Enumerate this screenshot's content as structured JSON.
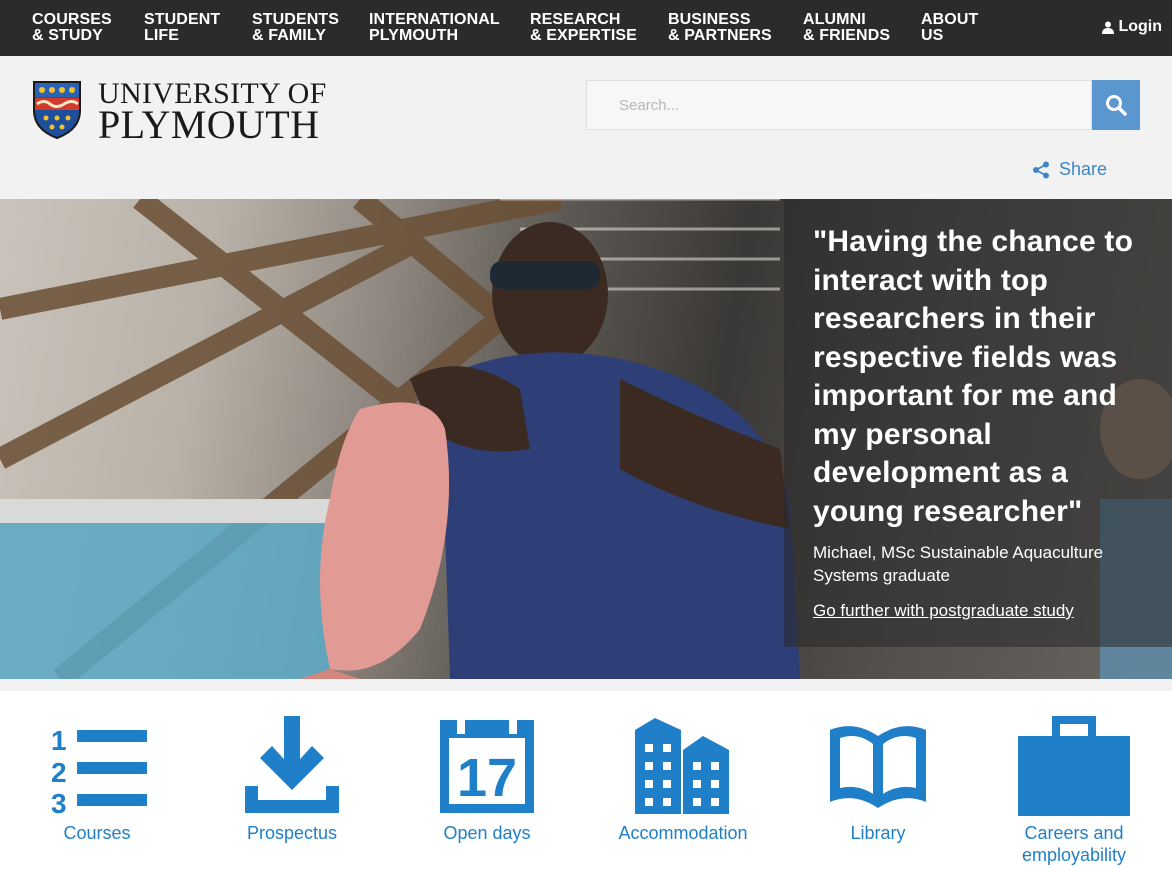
{
  "nav": {
    "items": [
      {
        "line1": "COURSES",
        "line2": "& STUDY"
      },
      {
        "line1": "STUDENT",
        "line2": "LIFE"
      },
      {
        "line1": "STUDENTS",
        "line2": "& FAMILY"
      },
      {
        "line1": "INTERNATIONAL",
        "line2": "PLYMOUTH"
      },
      {
        "line1": "RESEARCH",
        "line2": "& EXPERTISE"
      },
      {
        "line1": "BUSINESS",
        "line2": "& PARTNERS"
      },
      {
        "line1": "ALUMNI",
        "line2": "& FRIENDS"
      },
      {
        "line1": "ABOUT",
        "line2": "US"
      }
    ],
    "login_label": "Login"
  },
  "logo": {
    "line1": "UNIVERSITY OF",
    "line2": "PLYMOUTH"
  },
  "search": {
    "placeholder": "Search...",
    "value": ""
  },
  "share_label": "Share",
  "hero": {
    "quote": "\"Having the chance to interact with top researchers in their respective fields was important for me and my personal development as a young researcher\"",
    "attribution": "Michael, MSc Sustainable Aquaculture Systems graduate",
    "cta": "Go further with postgraduate study"
  },
  "quicklinks": [
    {
      "label": "Courses",
      "icon": "numbered-list-icon"
    },
    {
      "label": "Prospectus",
      "icon": "download-icon"
    },
    {
      "label": "Open days",
      "icon": "calendar-icon",
      "number": "17"
    },
    {
      "label": "Accommodation",
      "icon": "buildings-icon"
    },
    {
      "label": "Library",
      "icon": "open-book-icon"
    },
    {
      "label": "Careers and employability",
      "icon": "briefcase-icon"
    }
  ],
  "colors": {
    "nav_bg": "#2b2b2b",
    "header_bg": "#f2f2f2",
    "accent_blue": "#1f7fc8",
    "search_button": "#5b97cf",
    "share_blue": "#3d86c6"
  }
}
